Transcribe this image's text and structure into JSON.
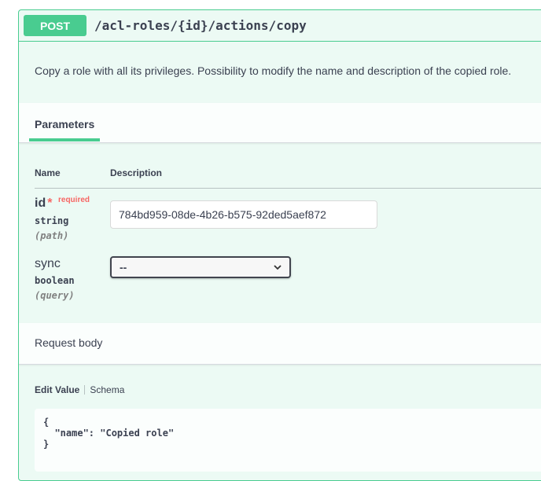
{
  "operation": {
    "method": "POST",
    "path": "/acl-roles/{id}/actions/copy",
    "description": "Copy a role with all its privileges. Possibility to modify the name and description of the copied role."
  },
  "parameters": {
    "tab_label": "Parameters",
    "col_name": "Name",
    "col_description": "Description",
    "items": [
      {
        "name": "id",
        "required_mark": "*",
        "required_label": "required",
        "type": "string",
        "in": "(path)",
        "value": "784bd959-08de-4b26-b575-92ded5aef872"
      },
      {
        "name": "sync",
        "type": "boolean",
        "in": "(query)",
        "selected": "--"
      }
    ]
  },
  "request_body": {
    "title": "Request body",
    "tab_edit": "Edit Value",
    "tab_schema": "Schema",
    "code": "{\n  \"name\": \"Copied role\"\n}"
  },
  "colors": {
    "post_green": "#49cc90",
    "text": "#3b4151",
    "required_red": "#ff0000"
  }
}
